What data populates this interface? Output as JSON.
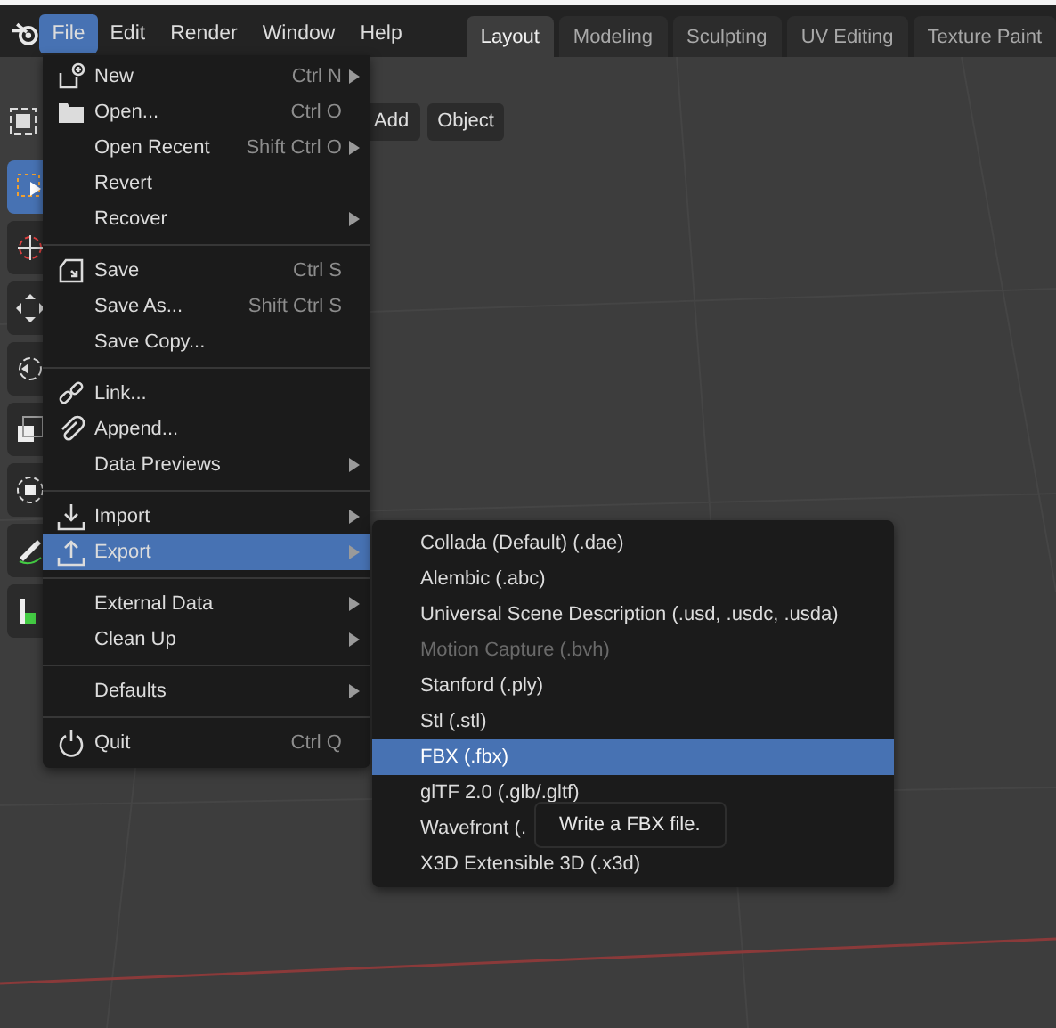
{
  "top_bar": {
    "menus": [
      {
        "label": "File",
        "selected": true
      },
      {
        "label": "Edit",
        "selected": false
      },
      {
        "label": "Render",
        "selected": false
      },
      {
        "label": "Window",
        "selected": false
      },
      {
        "label": "Help",
        "selected": false
      }
    ],
    "workspace_tabs": [
      {
        "label": "Layout",
        "selected": true
      },
      {
        "label": "Modeling",
        "selected": false
      },
      {
        "label": "Sculpting",
        "selected": false
      },
      {
        "label": "UV Editing",
        "selected": false
      },
      {
        "label": "Texture Paint",
        "selected": false
      }
    ]
  },
  "viewport_header": {
    "buttons": [
      "Add",
      "Object"
    ]
  },
  "toolbar": {
    "tools": [
      {
        "kind": "select",
        "selected": true
      },
      {
        "kind": "cursor",
        "selected": false
      },
      {
        "kind": "move",
        "selected": false
      },
      {
        "kind": "rotate",
        "selected": false
      },
      {
        "kind": "scale",
        "selected": false
      },
      {
        "kind": "transform",
        "selected": false
      },
      {
        "kind": "annotate",
        "selected": false
      },
      {
        "kind": "measure",
        "selected": false
      }
    ]
  },
  "file_menu": {
    "sections": [
      [
        {
          "kind": "new",
          "label": "New",
          "shortcut": "Ctrl N",
          "submenu": true,
          "highlighted": false
        },
        {
          "kind": "open",
          "label": "Open...",
          "shortcut": "Ctrl O",
          "submenu": false,
          "highlighted": false
        },
        {
          "kind": "plain",
          "label": "Open Recent",
          "shortcut": "Shift Ctrl O",
          "submenu": true,
          "highlighted": false
        },
        {
          "kind": "plain",
          "label": "Revert",
          "submenu": false,
          "highlighted": false
        },
        {
          "kind": "plain",
          "label": "Recover",
          "submenu": true,
          "highlighted": false
        }
      ],
      [
        {
          "kind": "save",
          "label": "Save",
          "shortcut": "Ctrl S",
          "submenu": false,
          "highlighted": false
        },
        {
          "kind": "plain",
          "label": "Save As...",
          "shortcut": "Shift Ctrl S",
          "submenu": false,
          "highlighted": false
        },
        {
          "kind": "plain",
          "label": "Save Copy...",
          "submenu": false,
          "highlighted": false
        }
      ],
      [
        {
          "kind": "link",
          "label": "Link...",
          "submenu": false,
          "highlighted": false
        },
        {
          "kind": "append",
          "label": "Append...",
          "submenu": false,
          "highlighted": false
        },
        {
          "kind": "plain",
          "label": "Data Previews",
          "submenu": true,
          "highlighted": false
        }
      ],
      [
        {
          "kind": "import",
          "label": "Import",
          "submenu": true,
          "highlighted": false
        },
        {
          "kind": "export",
          "label": "Export",
          "submenu": true,
          "highlighted": true
        }
      ],
      [
        {
          "kind": "plain",
          "label": "External Data",
          "submenu": true,
          "highlighted": false
        },
        {
          "kind": "plain",
          "label": "Clean Up",
          "submenu": true,
          "highlighted": false
        }
      ],
      [
        {
          "kind": "plain",
          "label": "Defaults",
          "submenu": true,
          "highlighted": false
        }
      ],
      [
        {
          "kind": "quit",
          "label": "Quit",
          "shortcut": "Ctrl Q",
          "submenu": false,
          "highlighted": false
        }
      ]
    ]
  },
  "export_menu": {
    "items": [
      {
        "label": "Collada (Default) (.dae)",
        "disabled": false,
        "highlighted": false
      },
      {
        "label": "Alembic (.abc)",
        "disabled": false,
        "highlighted": false
      },
      {
        "label": "Universal Scene Description (.usd, .usdc, .usda)",
        "disabled": false,
        "highlighted": false
      },
      {
        "label": "Motion Capture (.bvh)",
        "disabled": true,
        "highlighted": false
      },
      {
        "label": "Stanford (.ply)",
        "disabled": false,
        "highlighted": false
      },
      {
        "label": "Stl (.stl)",
        "disabled": false,
        "highlighted": false
      },
      {
        "label": "FBX (.fbx)",
        "disabled": false,
        "highlighted": true
      },
      {
        "label": "glTF 2.0 (.glb/.gltf)",
        "disabled": false,
        "highlighted": false
      },
      {
        "label": "Wavefront (.",
        "disabled": false,
        "highlighted": false
      },
      {
        "label": "X3D Extensible 3D (.x3d)",
        "disabled": false,
        "highlighted": false
      }
    ]
  },
  "tooltip": {
    "text": "Write a FBX file."
  }
}
